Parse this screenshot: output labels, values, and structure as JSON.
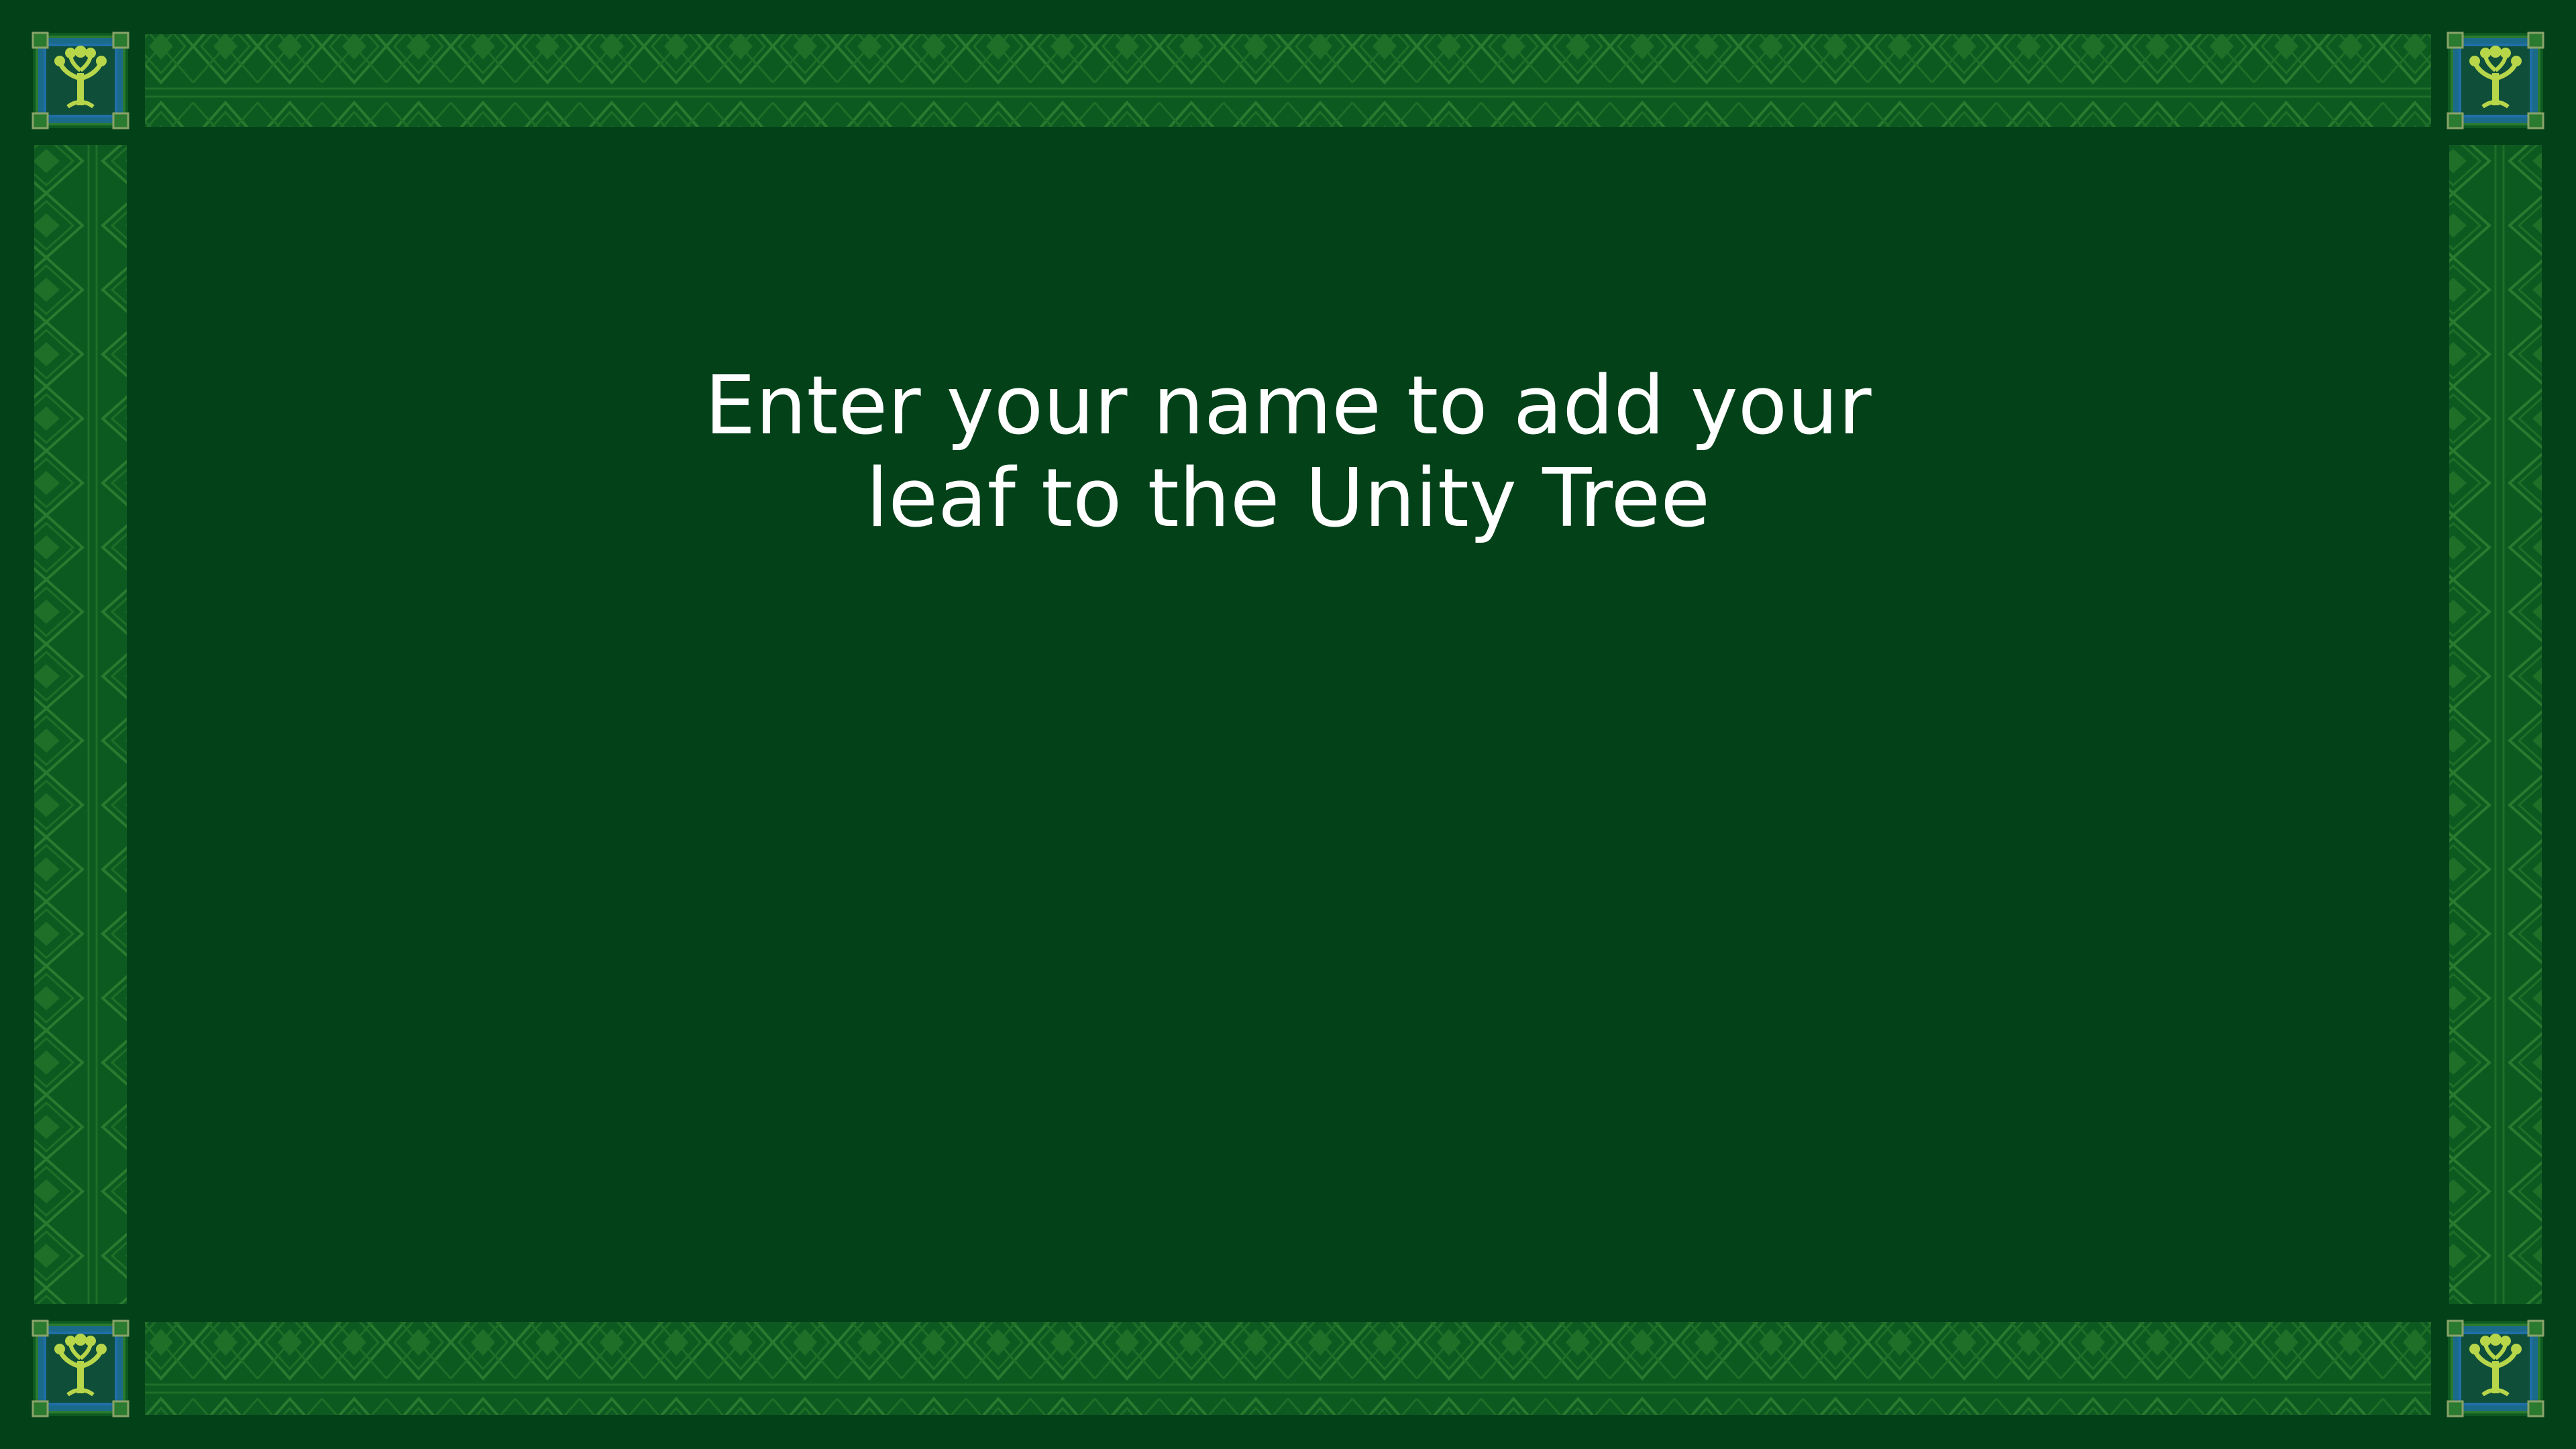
{
  "colors": {
    "background": "#034119",
    "border_band": "#0d5a21",
    "border_pattern": "#2a7a2f",
    "emblem_tree": "#b8d64a",
    "emblem_frame": "#1f6fa6",
    "text": "#ffffff"
  },
  "prompt": {
    "line1": "Enter your name to add your",
    "line2": "leaf to the Unity Tree"
  },
  "icons": {
    "corner_emblem": "unity-tree-emblem-icon"
  }
}
